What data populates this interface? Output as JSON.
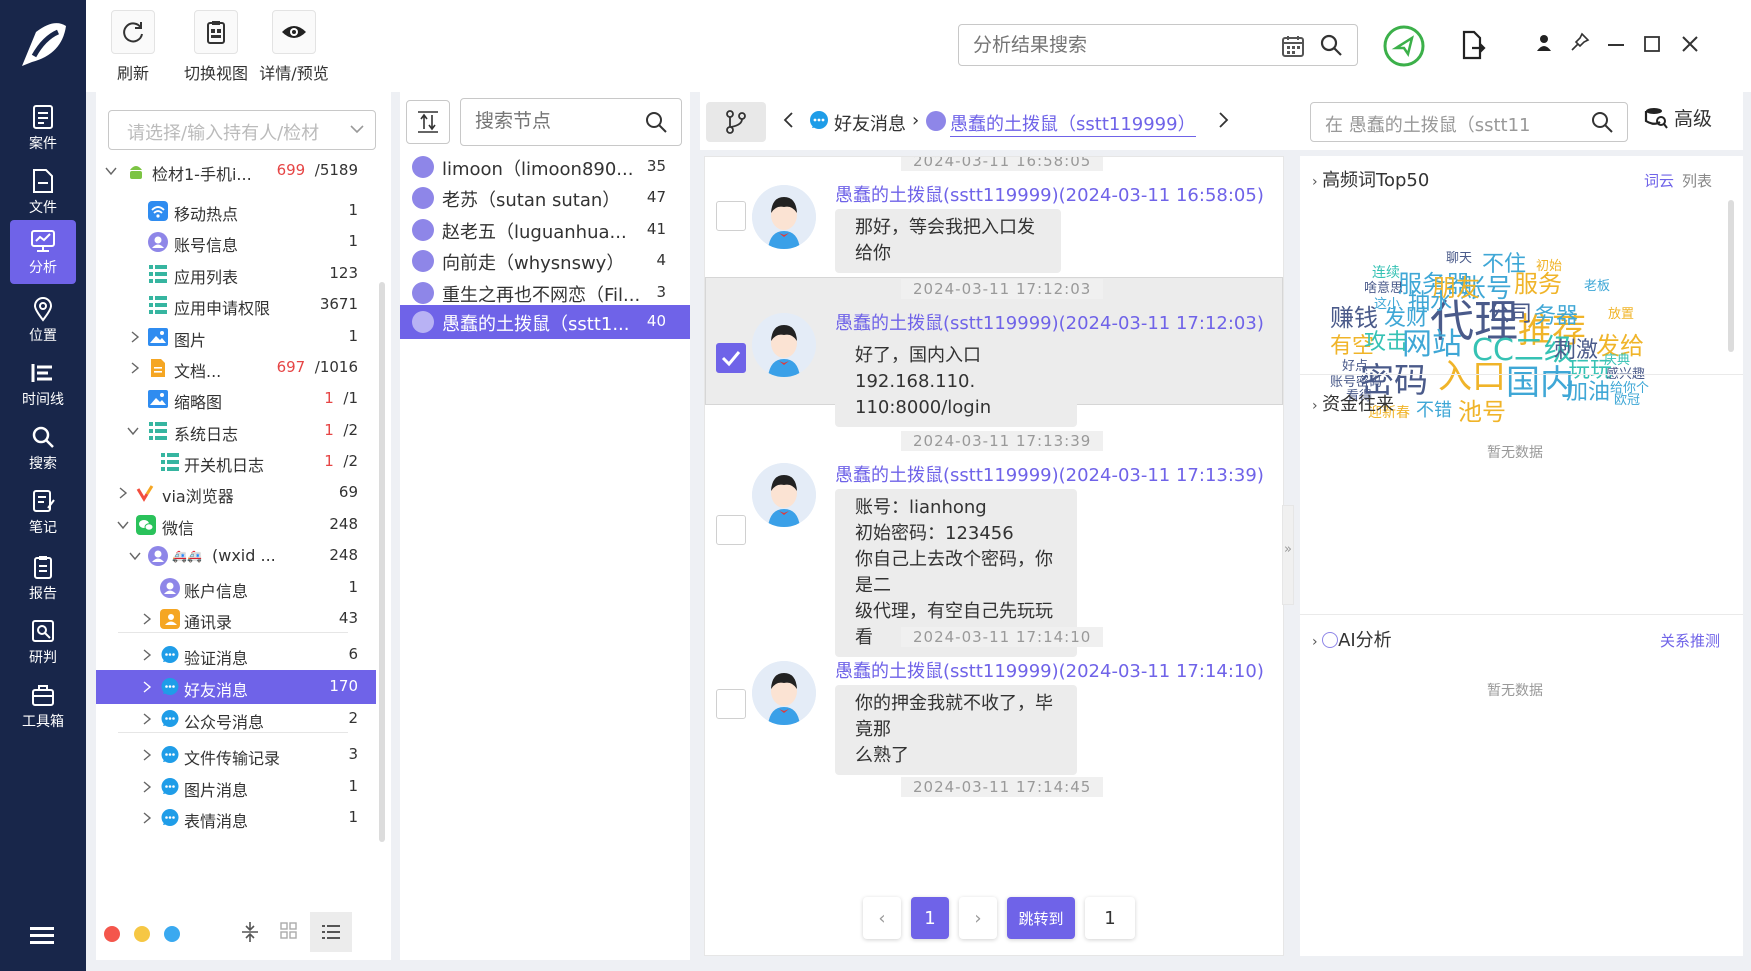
{
  "nav": {
    "items": [
      {
        "label": "案件"
      },
      {
        "label": "文件"
      },
      {
        "label": "分析"
      },
      {
        "label": "位置"
      },
      {
        "label": "时间线"
      },
      {
        "label": "搜索"
      },
      {
        "label": "笔记"
      },
      {
        "label": "报告"
      },
      {
        "label": "研判"
      },
      {
        "label": "工具箱"
      }
    ],
    "active": "分析",
    "accent": "#6f63e8",
    "bg": "#18264a"
  },
  "toolbar": {
    "refresh_label": "刷新",
    "switch_view_label": "切换视图",
    "details_label": "详情/预览",
    "search_placeholder": "分析结果搜索"
  },
  "tree": {
    "holder_placeholder": "请选择/输入持有人/检材",
    "rows": [
      {
        "label": "检材1-手机i...",
        "count_red": "699",
        "count": "/5189",
        "icon": "android-icon"
      },
      {
        "label": "移动热点",
        "count": "1",
        "icon": "wifi-icon"
      },
      {
        "label": "账号信息",
        "count": "1",
        "icon": "user-icon"
      },
      {
        "label": "应用列表",
        "count": "123",
        "icon": "list-icon"
      },
      {
        "label": "应用申请权限",
        "count": "3671",
        "icon": "list-icon"
      },
      {
        "label": "图片",
        "count": "1",
        "icon": "image-icon"
      },
      {
        "label": "文档...",
        "count_red": "697",
        "count": "/1016",
        "icon": "document-icon"
      },
      {
        "label": "缩略图",
        "count_red": "1",
        "count": "/1",
        "icon": "image-icon"
      },
      {
        "label": "系统日志",
        "count_red": "1",
        "count": "/2",
        "icon": "list-icon"
      },
      {
        "label": "开关机日志",
        "count_red": "1",
        "count": "/2",
        "icon": "list-icon"
      },
      {
        "label": "via浏览器",
        "count": "69",
        "icon": "via-browser-icon"
      },
      {
        "label": "微信",
        "count": "248",
        "icon": "wechat-icon"
      },
      {
        "label": "(wxid ...",
        "count": "248",
        "icon": "user-icon"
      },
      {
        "label": "账户信息",
        "count": "1",
        "icon": "user-icon"
      },
      {
        "label": "通讯录",
        "count": "43",
        "icon": "contacts-icon"
      },
      {
        "label": "验证消息",
        "count": "6",
        "icon": "chat-icon"
      },
      {
        "label": "好友消息",
        "count": "170",
        "icon": "chat-icon"
      },
      {
        "label": "公众号消息",
        "count": "2",
        "icon": "chat-icon"
      },
      {
        "label": "文件传输记录",
        "count": "3",
        "icon": "chat-icon"
      },
      {
        "label": "图片消息",
        "count": "1",
        "icon": "chat-icon"
      },
      {
        "label": "表情消息",
        "count": "1",
        "icon": "chat-icon"
      }
    ],
    "selected": "好友消息"
  },
  "contacts": {
    "search_placeholder": "搜索节点",
    "items": [
      {
        "name": "limoon（limoon890...",
        "count": "35"
      },
      {
        "name": "老苏（sutan sutan）",
        "count": "47"
      },
      {
        "name": "赵老五（luguanhua...",
        "count": "41"
      },
      {
        "name": "向前走（whysnswy）",
        "count": "4"
      },
      {
        "name": "重生之再也不网恋（Fil...",
        "count": "3"
      },
      {
        "name": "愚蠢的土拨鼠（sstt1...",
        "count": "40"
      }
    ],
    "selected_index": 5
  },
  "chat_header": {
    "crumb1": "好友消息",
    "crumb_sep": "›",
    "crumb2": "愚蠢的土拨鼠（sstt119999）",
    "in_search": "在 愚蠢的土拨鼠（sstt11",
    "advanced_label": "高级"
  },
  "messages": [
    {
      "timestamp": "2024-03-11 16:58:05",
      "sender": "愚蠢的土拨鼠(sstt119999)(2024-03-11 16:58:05)",
      "lines": [
        "那好，等会我把入口发给你"
      ],
      "checked": false
    },
    {
      "timestamp": "2024-03-11 17:12:03",
      "sender": "愚蠢的土拨鼠(sstt119999)(2024-03-11 17:12:03)",
      "lines": [
        "好了，国内入口192.168.110.",
        "110:8000/login"
      ],
      "checked": true
    },
    {
      "timestamp": "2024-03-11 17:13:39",
      "sender": "愚蠢的土拨鼠(sstt119999)(2024-03-11 17:13:39)",
      "lines": [
        "账号：lianhong",
        "初始密码：123456",
        "你自己上去改个密码，你是二",
        "级代理，有空自己先玩玩看"
      ],
      "checked": false
    },
    {
      "timestamp": "2024-03-11 17:14:10",
      "sender": "愚蠢的土拨鼠(sstt119999)(2024-03-11 17:14:10)",
      "lines": [
        "你的押金我就不收了，毕竟那",
        "么熟了"
      ],
      "checked": false
    }
  ],
  "last_timestamp": "2024-03-11 17:14:45",
  "pager": {
    "prev": "‹",
    "current": "1",
    "next": "›",
    "jump_label": "跳转到",
    "jump_value": "1"
  },
  "analysis": {
    "top_words_title": "高频词Top50",
    "wordcloud_label": "词云",
    "list_label": "列表",
    "funds_title": "资金往来",
    "funds_empty": "暂无数据",
    "ai_title": "AI分析",
    "ai_link": "关系推测",
    "ai_empty": "暂无数据",
    "words": [
      {
        "text": "代理",
        "color": "#4a5a8a"
      },
      {
        "text": "推荐",
        "color": "#f0b429"
      },
      {
        "text": "入口",
        "color": "#f0b429"
      },
      {
        "text": "密码",
        "color": "#4a5a8a"
      },
      {
        "text": "国内",
        "color": "#3fa7d6"
      },
      {
        "text": "网站",
        "color": "#3fa7d6"
      },
      {
        "text": "CC二级",
        "color": "#36c2b4"
      },
      {
        "text": "服务器",
        "color": "#3fa7d6"
      },
      {
        "text": "账号",
        "color": "#3fa7d6"
      },
      {
        "text": "服务",
        "color": "#f0b429"
      },
      {
        "text": "朋友",
        "color": "#f0b429"
      },
      {
        "text": "公司",
        "color": "#4a5a8a"
      },
      {
        "text": "务器",
        "color": "#3fa7d6"
      },
      {
        "text": "赚钱",
        "color": "#4a5a8a"
      },
      {
        "text": "发财",
        "color": "#3fa7d6"
      },
      {
        "text": "抽水",
        "color": "#3fa7d6"
      },
      {
        "text": "有空",
        "color": "#f0b429"
      },
      {
        "text": "攻击",
        "color": "#36c2b4"
      },
      {
        "text": "刺激",
        "color": "#4a5a8a"
      },
      {
        "text": "玩玩",
        "color": "#36c2b4"
      },
      {
        "text": "加油",
        "color": "#3fa7d6"
      },
      {
        "text": "不住",
        "color": "#3fa7d6"
      },
      {
        "text": "发给",
        "color": "#f0b429"
      },
      {
        "text": "聊天",
        "color": "#4a5a8a"
      },
      {
        "text": "连续",
        "color": "#36c2b4"
      },
      {
        "text": "啥意思",
        "color": "#4a5a8a"
      },
      {
        "text": "初始",
        "color": "#f0b429"
      },
      {
        "text": "老板",
        "color": "#3fa7d6"
      },
      {
        "text": "这小",
        "color": "#3fa7d6"
      },
      {
        "text": "放置",
        "color": "#f0b429"
      },
      {
        "text": "好点",
        "color": "#4a5a8a"
      },
      {
        "text": "账号密码",
        "color": "#4a5a8a"
      },
      {
        "text": "看得",
        "color": "#4a5a8a"
      },
      {
        "text": "庆典",
        "color": "#36c2b4"
      },
      {
        "text": "感兴趣",
        "color": "#4a5a8a"
      },
      {
        "text": "给你个",
        "color": "#3fa7d6"
      },
      {
        "text": "欧冠",
        "color": "#3fa7d6"
      },
      {
        "text": "迎新春",
        "color": "#f0b429"
      },
      {
        "text": "不错",
        "color": "#3fa7d6"
      },
      {
        "text": "池号",
        "color": "#f0b429"
      }
    ]
  },
  "colors": {
    "accent": "#6f63e8",
    "red_count": "#e64545",
    "nav_bg": "#18264a",
    "green_shield": "#3cb04a"
  }
}
